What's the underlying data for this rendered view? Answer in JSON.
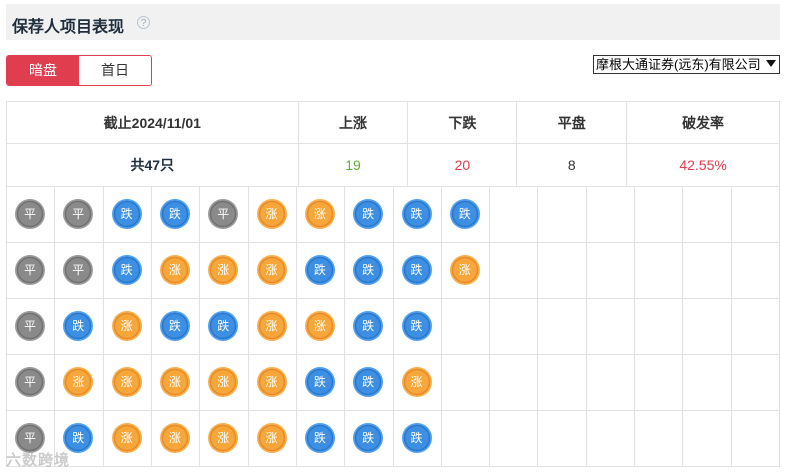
{
  "header": {
    "title": "保荐人项目表现",
    "help": "?"
  },
  "tabs": [
    {
      "label": "暗盘",
      "active": true
    },
    {
      "label": "首日",
      "active": false
    }
  ],
  "broker_select": {
    "selected": "摩根大通证券(远东)有限公司"
  },
  "stats": {
    "headers": [
      "截止2024/11/01",
      "上涨",
      "下跌",
      "平盘",
      "破发率"
    ],
    "values": {
      "total": "共47只",
      "up": "19",
      "down": "20",
      "flat": "8",
      "rate": "42.55%"
    }
  },
  "columns": [
    [
      "平",
      "平",
      "平",
      "平",
      "平"
    ],
    [
      "平",
      "平",
      "跌",
      "涨",
      "跌"
    ],
    [
      "跌",
      "跌",
      "涨",
      "涨",
      "涨"
    ],
    [
      "跌",
      "涨",
      "跌",
      "涨",
      "涨"
    ],
    [
      "平",
      "涨",
      "跌",
      "涨",
      "涨"
    ],
    [
      "涨",
      "涨",
      "涨",
      "涨",
      "涨"
    ],
    [
      "涨",
      "跌",
      "涨",
      "跌",
      "跌"
    ],
    [
      "跌",
      "跌",
      "跌",
      "跌",
      "跌"
    ],
    [
      "跌",
      "跌",
      "跌",
      "涨",
      "跌"
    ],
    [
      "跌",
      "涨"
    ]
  ],
  "labels": {
    "flat": "平",
    "up": "涨",
    "down": "跌"
  },
  "colors": {
    "accent": "#e03d4e",
    "up_text": "#5fb036",
    "down_text": "#e03d4e"
  },
  "watermark": "六数跨境"
}
